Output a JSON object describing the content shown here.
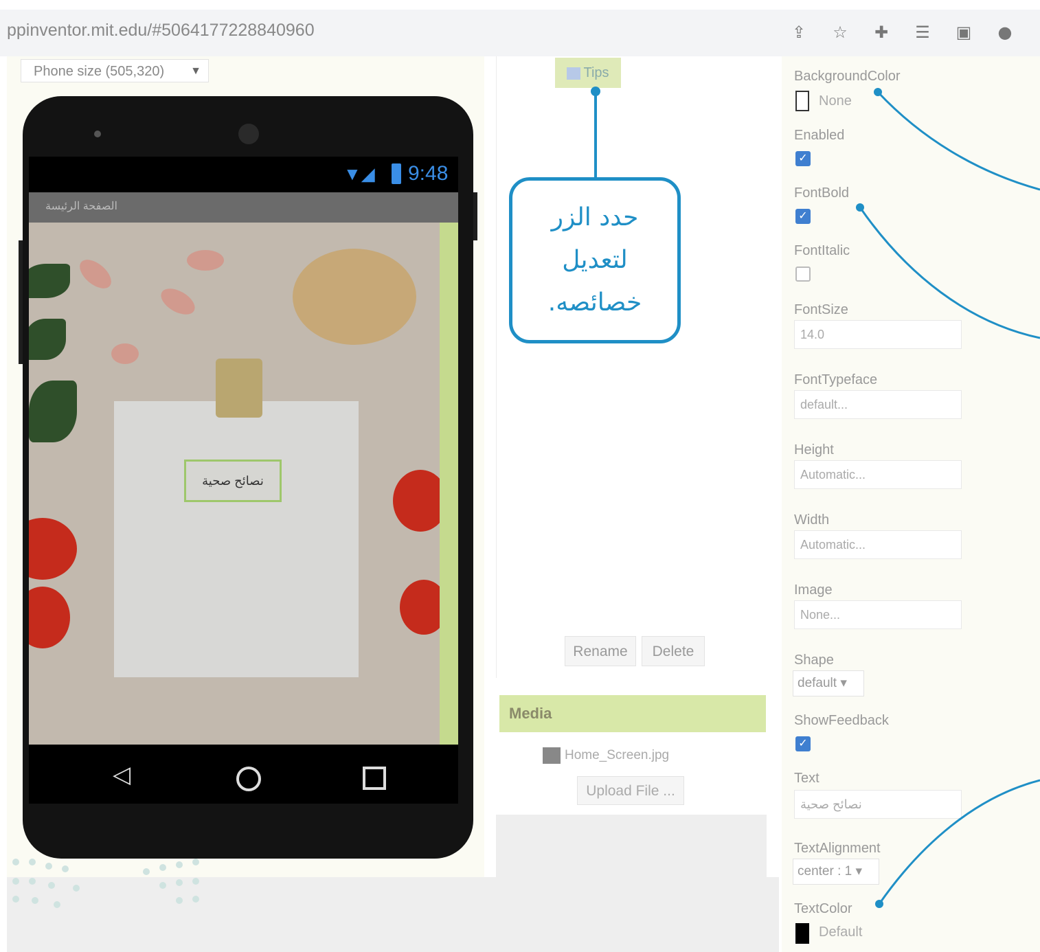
{
  "browser": {
    "url": "ppinventor.mit.edu/#5064177228840960",
    "toolbar_icons": [
      "share-icon",
      "star-icon",
      "extensions-icon",
      "playlist-icon",
      "sidepanel-icon",
      "profile-icon"
    ]
  },
  "viewer": {
    "phone_size_label": "Phone size (505,320)",
    "status_time": "9:48",
    "app_title": "الصفحة الرئيسة",
    "button_text": "نصائح صحية"
  },
  "components": {
    "selected_node": "Tips",
    "rename_label": "Rename",
    "delete_label": "Delete"
  },
  "media": {
    "header": "Media",
    "file_name": "Home_Screen.jpg",
    "upload_label": "Upload File ..."
  },
  "callout": {
    "line1": "حدد الزر",
    "line2": "لتعديل",
    "line3": "خصائصه."
  },
  "properties": {
    "background_color": {
      "label": "BackgroundColor",
      "value": "None"
    },
    "enabled": {
      "label": "Enabled",
      "checked": true
    },
    "font_bold": {
      "label": "FontBold",
      "checked": true
    },
    "font_italic": {
      "label": "FontItalic",
      "checked": false
    },
    "font_size": {
      "label": "FontSize",
      "value": "14.0"
    },
    "font_typeface": {
      "label": "FontTypeface",
      "value": "default..."
    },
    "height": {
      "label": "Height",
      "value": "Automatic..."
    },
    "width": {
      "label": "Width",
      "value": "Automatic..."
    },
    "image": {
      "label": "Image",
      "value": "None..."
    },
    "shape": {
      "label": "Shape",
      "value": "default ▾"
    },
    "show_feedback": {
      "label": "ShowFeedback",
      "checked": true
    },
    "text": {
      "label": "Text",
      "value": "نصائح صحية"
    },
    "text_alignment": {
      "label": "TextAlignment",
      "value": "center : 1 ▾"
    },
    "text_color": {
      "label": "TextColor",
      "value": "Default"
    }
  },
  "colors": {
    "accent": "#1f8fc6",
    "checkbox": "#3f7fd0",
    "media_header": "#d8e8a8"
  }
}
